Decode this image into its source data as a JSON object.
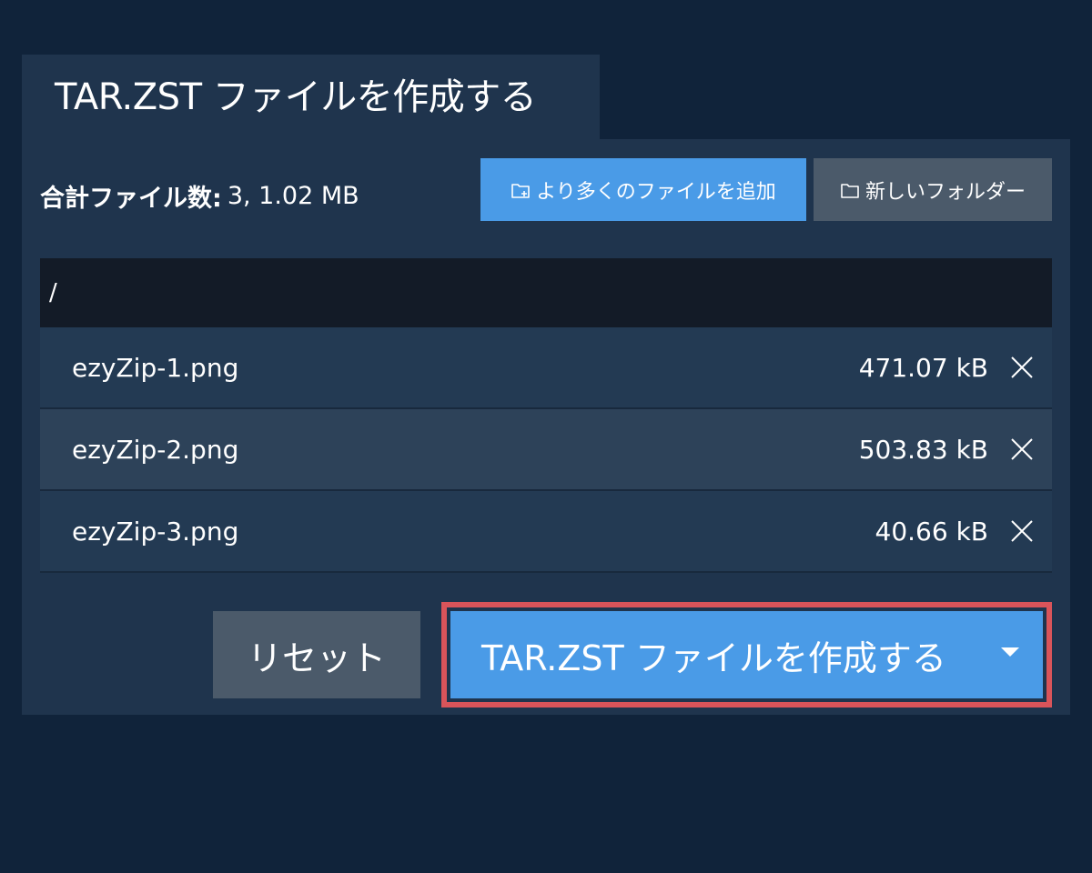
{
  "header": {
    "title": "TAR.ZST ファイルを作成する"
  },
  "summary": {
    "label": "合計ファイル数:",
    "value": "3, 1.02 MB"
  },
  "toolbar": {
    "add_files_label": "より多くのファイルを追加",
    "new_folder_label": "新しいフォルダー"
  },
  "path": {
    "current": "/"
  },
  "files": [
    {
      "name": "ezyZip-1.png",
      "size": "471.07 kB"
    },
    {
      "name": "ezyZip-2.png",
      "size": "503.83 kB"
    },
    {
      "name": "ezyZip-3.png",
      "size": "40.66 kB"
    }
  ],
  "actions": {
    "reset_label": "リセット",
    "create_label": "TAR.ZST ファイルを作成する"
  },
  "icons": {
    "add_folder": "folder-plus-icon",
    "new_folder": "folder-icon",
    "remove": "close-icon",
    "dropdown": "caret-down-icon"
  },
  "colors": {
    "background": "#10233a",
    "panel": "#1f344d",
    "primary": "#4a9be7",
    "secondary": "#4b5a6a",
    "highlight": "#d9545a"
  }
}
